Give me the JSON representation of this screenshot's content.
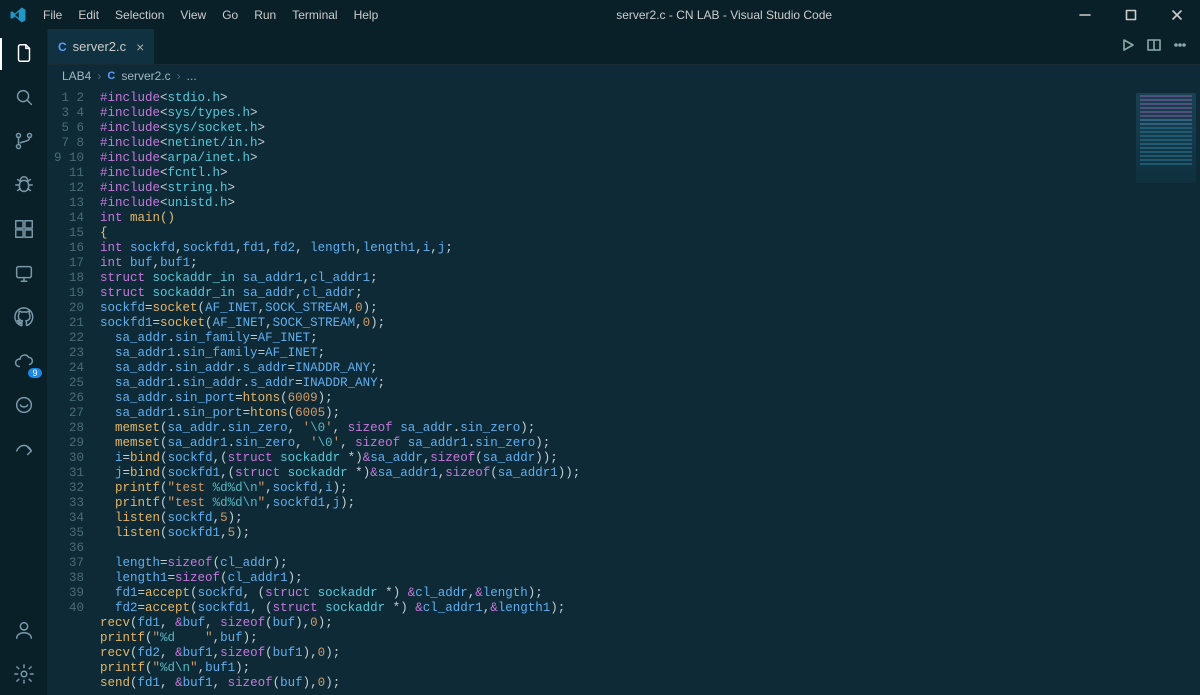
{
  "window": {
    "title": "server2.c - CN LAB - Visual Studio Code"
  },
  "menu": {
    "items": [
      "File",
      "Edit",
      "Selection",
      "View",
      "Go",
      "Run",
      "Terminal",
      "Help"
    ]
  },
  "activity": {
    "badge_count": "9"
  },
  "tab": {
    "filename": "server2.c"
  },
  "breadcrumbs": {
    "folder": "LAB4",
    "file": "server2.c",
    "trail": "..."
  },
  "code": {
    "lines": [
      {
        "n": 1,
        "kind": "include",
        "hdr": "stdio.h"
      },
      {
        "n": 2,
        "kind": "include",
        "hdr": "sys/types.h"
      },
      {
        "n": 3,
        "kind": "include",
        "hdr": "sys/socket.h"
      },
      {
        "n": 4,
        "kind": "include",
        "hdr": "netinet/in.h"
      },
      {
        "n": 5,
        "kind": "include",
        "hdr": "arpa/inet.h"
      },
      {
        "n": 6,
        "kind": "include",
        "hdr": "fcntl.h"
      },
      {
        "n": 7,
        "kind": "include",
        "hdr": "string.h"
      },
      {
        "n": 8,
        "kind": "include",
        "hdr": "unistd.h"
      },
      {
        "n": 9,
        "kind": "raw",
        "html": "<span class='tok-kw'>int</span> <span class='tok-fn'>main</span><span class='tok-br'>()</span>"
      },
      {
        "n": 10,
        "kind": "raw",
        "html": "<span class='tok-br'>{</span>"
      },
      {
        "n": 11,
        "kind": "raw",
        "html": "<span class='tok-kw'>int</span> <span class='tok-var'>sockfd</span>,<span class='tok-var'>sockfd1</span>,<span class='tok-var'>fd1</span>,<span class='tok-var'>fd2</span>, <span class='tok-var'>length</span>,<span class='tok-var'>length1</span>,<span class='tok-var'>i</span>,<span class='tok-var'>j</span>;"
      },
      {
        "n": 12,
        "kind": "raw",
        "html": "<span class='tok-kw'>int</span> <span class='tok-var'>buf</span>,<span class='tok-var'>buf1</span>;"
      },
      {
        "n": 13,
        "kind": "raw",
        "html": "<span class='tok-kw'>struct</span> <span class='tok-type'>sockaddr_in</span> <span class='tok-var'>sa_addr1</span>,<span class='tok-var'>cl_addr1</span>;"
      },
      {
        "n": 14,
        "kind": "raw",
        "html": "<span class='tok-kw'>struct</span> <span class='tok-type'>sockaddr_in</span> <span class='tok-var'>sa_addr</span>,<span class='tok-var'>cl_addr</span>;"
      },
      {
        "n": 15,
        "kind": "raw",
        "html": "<span class='tok-var'>sockfd</span>=<span class='tok-fn'>socket</span>(<span class='tok-var'>AF_INET</span>,<span class='tok-var'>SOCK_STREAM</span>,<span class='tok-num'>0</span>);"
      },
      {
        "n": 16,
        "kind": "raw",
        "html": "<span class='tok-var'>sockfd1</span>=<span class='tok-fn'>socket</span>(<span class='tok-var'>AF_INET</span>,<span class='tok-var'>SOCK_STREAM</span>,<span class='tok-num'>0</span>);"
      },
      {
        "n": 17,
        "kind": "raw",
        "indent": 1,
        "html": "<span class='tok-var'>sa_addr</span>.<span class='tok-var'>sin_family</span>=<span class='tok-var'>AF_INET</span>;"
      },
      {
        "n": 18,
        "kind": "raw",
        "indent": 1,
        "html": "<span class='tok-var'>sa_addr1</span>.<span class='tok-var'>sin_family</span>=<span class='tok-var'>AF_INET</span>;"
      },
      {
        "n": 19,
        "kind": "raw",
        "indent": 1,
        "html": "<span class='tok-var'>sa_addr</span>.<span class='tok-var'>sin_addr</span>.<span class='tok-var'>s_addr</span>=<span class='tok-var'>INADDR_ANY</span>;"
      },
      {
        "n": 20,
        "kind": "raw",
        "indent": 1,
        "html": "<span class='tok-var'>sa_addr1</span>.<span class='tok-var'>sin_addr</span>.<span class='tok-var'>s_addr</span>=<span class='tok-var'>INADDR_ANY</span>;"
      },
      {
        "n": 21,
        "kind": "raw",
        "indent": 1,
        "html": "<span class='tok-var'>sa_addr</span>.<span class='tok-var'>sin_port</span>=<span class='tok-fn'>htons</span>(<span class='tok-num'>6009</span>);"
      },
      {
        "n": 22,
        "kind": "raw",
        "indent": 1,
        "html": "<span class='tok-var'>sa_addr1</span>.<span class='tok-var'>sin_port</span>=<span class='tok-fn'>htons</span>(<span class='tok-num'>6005</span>);"
      },
      {
        "n": 23,
        "kind": "raw",
        "indent": 1,
        "html": "<span class='tok-fn'>memset</span>(<span class='tok-var'>sa_addr</span>.<span class='tok-var'>sin_zero</span>, <span class='tok-str'>'<span class='tok-esc'>\\0</span>'</span>, <span class='tok-kw'>sizeof</span> <span class='tok-var'>sa_addr</span>.<span class='tok-var'>sin_zero</span>);"
      },
      {
        "n": 24,
        "kind": "raw",
        "indent": 1,
        "html": "<span class='tok-fn'>memset</span>(<span class='tok-var'>sa_addr1</span>.<span class='tok-var'>sin_zero</span>, <span class='tok-str'>'<span class='tok-esc'>\\0</span>'</span>, <span class='tok-kw'>sizeof</span> <span class='tok-var'>sa_addr1</span>.<span class='tok-var'>sin_zero</span>);"
      },
      {
        "n": 25,
        "kind": "raw",
        "indent": 1,
        "html": "<span class='tok-var'>i</span>=<span class='tok-fn'>bind</span>(<span class='tok-var'>sockfd</span>,(<span class='tok-kw'>struct</span> <span class='tok-type'>sockaddr</span> <span class='tok-op'>*</span>)<span class='tok-amp'>&amp;</span><span class='tok-var'>sa_addr</span>,<span class='tok-kw'>sizeof</span>(<span class='tok-var'>sa_addr</span>));"
      },
      {
        "n": 26,
        "kind": "raw",
        "indent": 1,
        "html": "<span class='tok-var'>j</span>=<span class='tok-fn'>bind</span>(<span class='tok-var'>sockfd1</span>,(<span class='tok-kw'>struct</span> <span class='tok-type'>sockaddr</span> <span class='tok-op'>*</span>)<span class='tok-amp'>&amp;</span><span class='tok-var'>sa_addr1</span>,<span class='tok-kw'>sizeof</span>(<span class='tok-var'>sa_addr1</span>));"
      },
      {
        "n": 27,
        "kind": "raw",
        "indent": 1,
        "html": "<span class='tok-fn'>printf</span>(<span class='tok-str'>\"test <span class='tok-esc'>%d%d\\n</span>\"</span>,<span class='tok-var'>sockfd</span>,<span class='tok-var'>i</span>);"
      },
      {
        "n": 28,
        "kind": "raw",
        "indent": 1,
        "html": "<span class='tok-fn'>printf</span>(<span class='tok-str'>\"test <span class='tok-esc'>%d%d\\n</span>\"</span>,<span class='tok-var'>sockfd1</span>,<span class='tok-var'>j</span>);"
      },
      {
        "n": 29,
        "kind": "raw",
        "indent": 1,
        "html": "<span class='tok-fn'>listen</span>(<span class='tok-var'>sockfd</span>,<span class='tok-num'>5</span>);"
      },
      {
        "n": 30,
        "kind": "raw",
        "indent": 1,
        "html": "<span class='tok-fn'>listen</span>(<span class='tok-var'>sockfd1</span>,<span class='tok-num'>5</span>);"
      },
      {
        "n": 31,
        "kind": "raw",
        "html": ""
      },
      {
        "n": 32,
        "kind": "raw",
        "indent": 1,
        "html": "<span class='tok-var'>length</span>=<span class='tok-kw'>sizeof</span>(<span class='tok-var'>cl_addr</span>);"
      },
      {
        "n": 33,
        "kind": "raw",
        "indent": 1,
        "html": "<span class='tok-var'>length1</span>=<span class='tok-kw'>sizeof</span>(<span class='tok-var'>cl_addr1</span>);"
      },
      {
        "n": 34,
        "kind": "raw",
        "indent": 1,
        "html": "<span class='tok-var'>fd1</span>=<span class='tok-fn'>accept</span>(<span class='tok-var'>sockfd</span>, (<span class='tok-kw'>struct</span> <span class='tok-type'>sockaddr</span> <span class='tok-op'>*</span>) <span class='tok-amp'>&amp;</span><span class='tok-var'>cl_addr</span>,<span class='tok-amp'>&amp;</span><span class='tok-var'>length</span>);"
      },
      {
        "n": 35,
        "kind": "raw",
        "indent": 1,
        "html": "<span class='tok-var'>fd2</span>=<span class='tok-fn'>accept</span>(<span class='tok-var'>sockfd1</span>, (<span class='tok-kw'>struct</span> <span class='tok-type'>sockaddr</span> <span class='tok-op'>*</span>) <span class='tok-amp'>&amp;</span><span class='tok-var'>cl_addr1</span>,<span class='tok-amp'>&amp;</span><span class='tok-var'>length1</span>);"
      },
      {
        "n": 36,
        "kind": "raw",
        "html": "<span class='tok-fn'>recv</span>(<span class='tok-var'>fd1</span>, <span class='tok-amp'>&amp;</span><span class='tok-var'>buf</span>, <span class='tok-kw'>sizeof</span>(<span class='tok-var'>buf</span>),<span class='tok-num'>0</span>);"
      },
      {
        "n": 37,
        "kind": "raw",
        "html": "<span class='tok-fn'>printf</span>(<span class='tok-str'>\"<span class='tok-esc'>%d</span>    \"</span>,<span class='tok-var'>buf</span>);"
      },
      {
        "n": 38,
        "kind": "raw",
        "html": "<span class='tok-fn'>recv</span>(<span class='tok-var'>fd2</span>, <span class='tok-amp'>&amp;</span><span class='tok-var'>buf1</span>,<span class='tok-kw'>sizeof</span>(<span class='tok-var'>buf1</span>),<span class='tok-num'>0</span>);"
      },
      {
        "n": 39,
        "kind": "raw",
        "html": "<span class='tok-fn'>printf</span>(<span class='tok-str'>\"<span class='tok-esc'>%d\\n</span>\"</span>,<span class='tok-var'>buf1</span>);"
      },
      {
        "n": 40,
        "kind": "raw",
        "html": "<span class='tok-fn'>send</span>(<span class='tok-var'>fd1</span>, <span class='tok-amp'>&amp;</span><span class='tok-var'>buf1</span>, <span class='tok-kw'>sizeof</span>(<span class='tok-var'>buf</span>),<span class='tok-num'>0</span>);"
      }
    ]
  }
}
